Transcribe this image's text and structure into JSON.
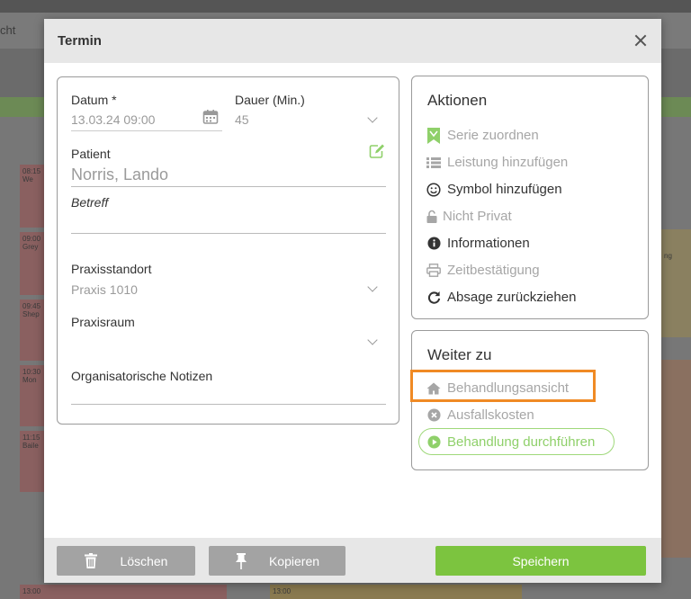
{
  "background": {
    "tab_partial": "cht",
    "events": [
      {
        "time": "08:15",
        "text": "We"
      },
      {
        "time": "09:00",
        "text": "Grey"
      },
      {
        "time": "09:45",
        "text": "Shep"
      },
      {
        "time": "10:30",
        "text": "Mon"
      },
      {
        "time": "11:15",
        "text": "Baile"
      },
      {
        "time": "13:00",
        "text": ""
      },
      {
        "time": "13:00",
        "text": ""
      }
    ],
    "right_partial": "ng"
  },
  "modal": {
    "title": "Termin",
    "close_label": "×"
  },
  "form": {
    "datum_label": "Datum *",
    "datum_value": "13.03.24 09:00",
    "dauer_label": "Dauer (Min.)",
    "dauer_value": "45",
    "patient_label": "Patient",
    "patient_value": "Norris, Lando",
    "betreff_placeholder": "Betreff",
    "praxisstandort_label": "Praxisstandort",
    "praxisstandort_value": "Praxis 1010",
    "praxisraum_label": "Praxisraum",
    "praxisraum_value": "",
    "notizen_label": "Organisatorische Notizen"
  },
  "aktionen": {
    "title": "Aktionen",
    "items": [
      {
        "label": "Serie zuordnen",
        "icon": "bookmark-icon",
        "state": "green"
      },
      {
        "label": "Leistung hinzufügen",
        "icon": "list-icon",
        "state": "dim"
      },
      {
        "label": "Symbol hinzufügen",
        "icon": "smiley-icon",
        "state": "dark"
      },
      {
        "label": "Nicht Privat",
        "icon": "unlock-icon",
        "state": "dim"
      },
      {
        "label": "Informationen",
        "icon": "info-icon",
        "state": "dark"
      },
      {
        "label": "Zeitbestätigung",
        "icon": "printer-icon",
        "state": "dim"
      },
      {
        "label": "Absage zurückziehen",
        "icon": "refresh-icon",
        "state": "dark"
      }
    ]
  },
  "weiter": {
    "title": "Weiter zu",
    "items": [
      {
        "label": "Behandlungsansicht",
        "icon": "home-icon",
        "state": "dim"
      },
      {
        "label": "Ausfallskosten",
        "icon": "x-circle-icon",
        "state": "dim"
      },
      {
        "label": "Behandlung durchführen",
        "icon": "play-circle-icon",
        "state": "green"
      }
    ]
  },
  "footer": {
    "delete_label": "Löschen",
    "copy_label": "Kopieren",
    "save_label": "Speichern"
  },
  "colors": {
    "accent_green": "#7cc43f",
    "highlight_orange": "#f08a24",
    "button_grey": "#a3a3a3"
  }
}
